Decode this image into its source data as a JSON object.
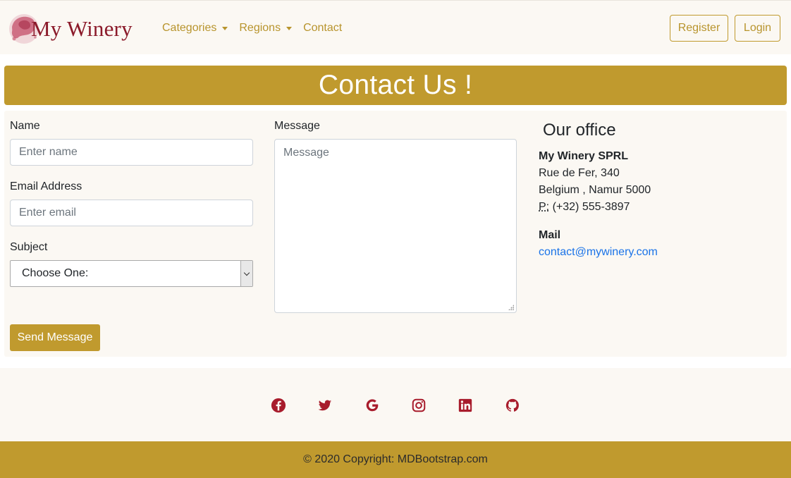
{
  "navbar": {
    "brand": "My Winery",
    "links": [
      {
        "label": "Categories",
        "dropdown": true
      },
      {
        "label": "Regions",
        "dropdown": true
      },
      {
        "label": "Contact",
        "dropdown": false
      }
    ],
    "register_label": "Register",
    "login_label": "Login"
  },
  "banner": {
    "title": "Contact Us !"
  },
  "form": {
    "name_label": "Name",
    "name_placeholder": "Enter name",
    "email_label": "Email Address",
    "email_placeholder": "Enter email",
    "subject_label": "Subject",
    "subject_selected": "Choose One:",
    "message_label": "Message",
    "message_placeholder": "Message",
    "send_label": "Send Message"
  },
  "office": {
    "title": "Our office",
    "company": "My Winery SPRL",
    "street": "Rue de Fer, 340",
    "city": "Belgium , Namur 5000",
    "phone_prefix": "P:",
    "phone": "(+32) 555-3897",
    "mail_heading": "Mail",
    "email": "contact@mywinery.com"
  },
  "social": [
    "facebook-icon",
    "twitter-icon",
    "google-icon",
    "instagram-icon",
    "linkedin-icon",
    "github-icon"
  ],
  "footer": {
    "copyright": "© 2020 Copyright: MDBootstrap.com"
  },
  "colors": {
    "accent": "#c09a2e",
    "brand": "#8b1a2a",
    "social_icon": "#a81c2c",
    "panel_bg": "#fbf8f3",
    "link": "#1a73e8"
  }
}
